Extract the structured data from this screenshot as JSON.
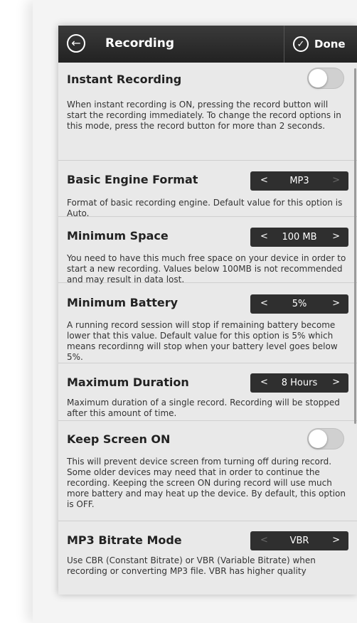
{
  "nav": {
    "title": "Recording",
    "done_label": "Done",
    "back_icon": "back-arrow-circle-icon",
    "done_icon": "checkmark-circle-icon"
  },
  "settings": [
    {
      "title": "Instant Recording",
      "control": "toggle",
      "on": false,
      "description": "When instant recording is ON, pressing the record button will start the recording immediately. To change the record options in this mode, press the record button for more than 2 seconds."
    },
    {
      "title": "Basic Engine Format",
      "control": "stepper",
      "value": "MP3",
      "description": "Format of basic recording engine. Default value for this option is Auto."
    },
    {
      "title": "Minimum Space",
      "control": "stepper",
      "value": "100 MB",
      "description": "You need to have this much free space on your device in order to start a new recording. Values below 100MB is not recommended and may result in data lost."
    },
    {
      "title": "Minimum Battery",
      "control": "stepper",
      "value": "5%",
      "description": "A running record session will stop if remaining battery become lower that this value. Default value for this option is 5% which means recordinng will stop when your battery level goes below 5%."
    },
    {
      "title": "Maximum Duration",
      "control": "stepper",
      "value": "8 Hours",
      "description": "Maximum duration of a single record. Recording will be stopped after this amount of time."
    },
    {
      "title": "Keep Screen ON",
      "control": "toggle",
      "on": false,
      "description": "This will prevent device screen from turning off during record. Some older devices may need that in order to continue the recording. Keeping the screen ON during record will use much more battery and may heat up the device. By default, this option is OFF."
    },
    {
      "title": "MP3 Bitrate Mode",
      "control": "stepper",
      "value": "VBR",
      "description": "Use CBR (Constant Bitrate) or VBR (Variable Bitrate) when recording or converting MP3 file. VBR has higher quality"
    }
  ],
  "glyphs": {
    "left": "<",
    "right": ">",
    "back": "←",
    "check": "✓"
  },
  "colors": {
    "navbar": "#2a2a2a",
    "background": "#e9e9e9",
    "stepper": "#2f2f2f",
    "toggle_off": "#d0d0d0"
  }
}
